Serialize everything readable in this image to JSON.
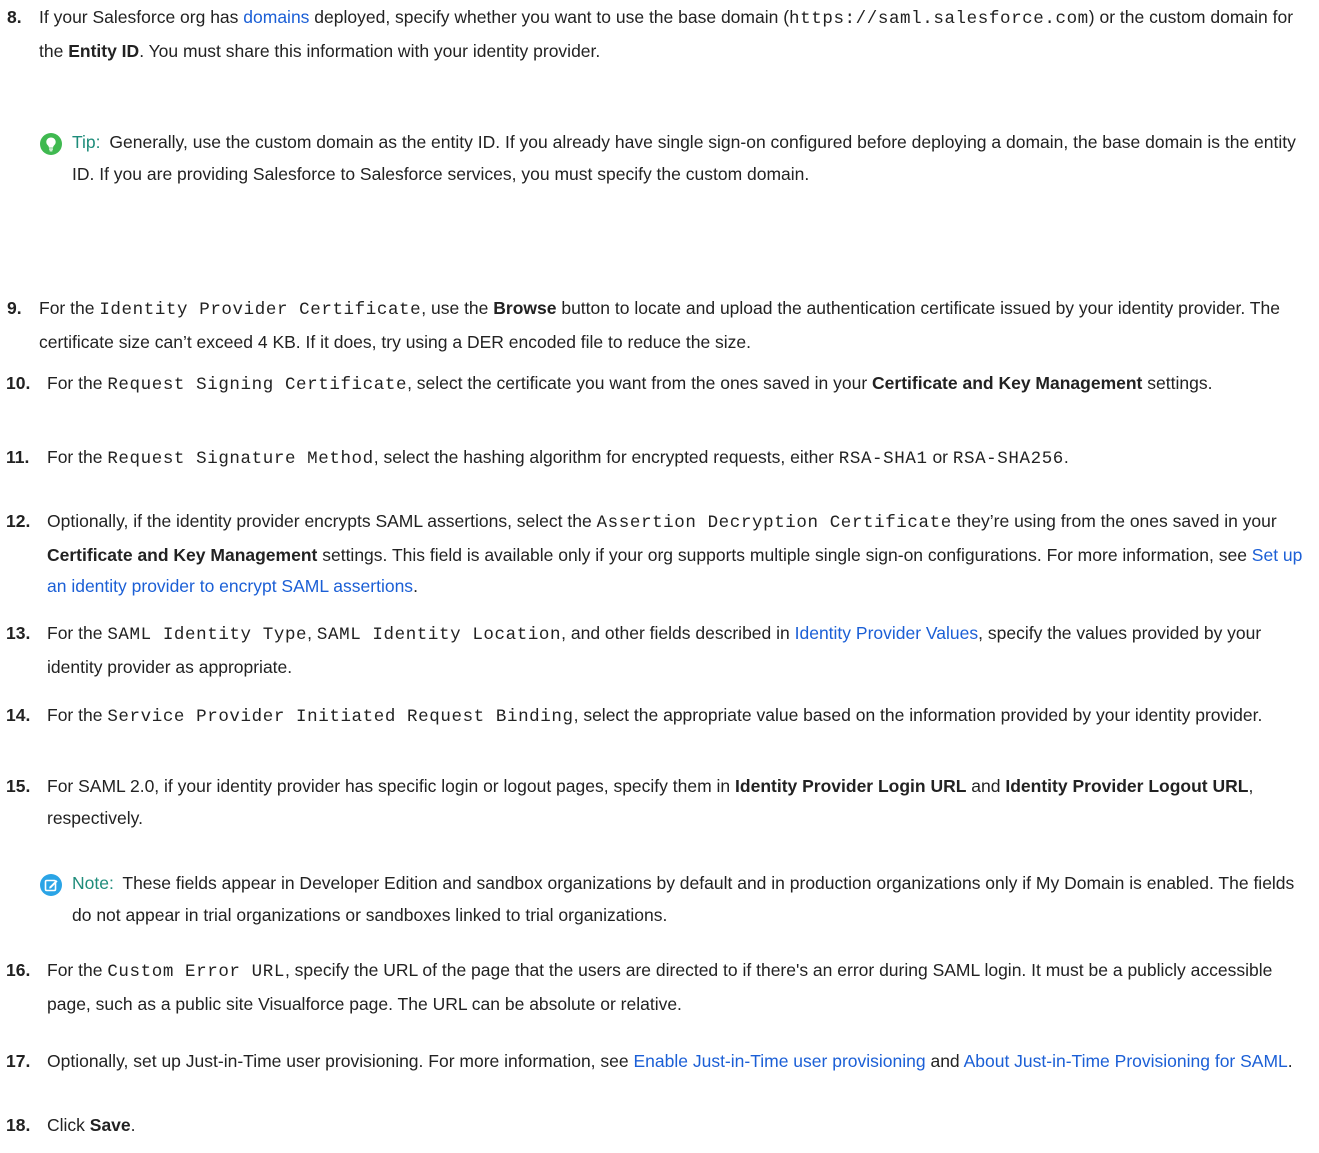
{
  "steps": [
    {
      "num": "8.",
      "parts": [
        {
          "t": "text",
          "v": "If your Salesforce org has "
        },
        {
          "t": "link",
          "v": "domains"
        },
        {
          "t": "text",
          "v": " deployed, specify whether you want to use the base domain ("
        },
        {
          "t": "code",
          "v": "https://saml.salesforce.com"
        },
        {
          "t": "text",
          "v": ") or the custom domain for the "
        },
        {
          "t": "bold",
          "v": "Entity ID"
        },
        {
          "t": "text",
          "v": ". You must share this information with your identity provider."
        }
      ]
    },
    {
      "num": "9.",
      "parts": [
        {
          "t": "text",
          "v": "For the "
        },
        {
          "t": "code",
          "v": "Identity Provider Certificate"
        },
        {
          "t": "text",
          "v": ", use the "
        },
        {
          "t": "bold",
          "v": "Browse"
        },
        {
          "t": "text",
          "v": " button to locate and upload the authentication certificate issued by your identity provider. The certificate size can’t exceed 4 KB. If it does, try using a DER encoded file to reduce the size."
        }
      ]
    },
    {
      "num": "10.",
      "parts": [
        {
          "t": "text",
          "v": "For the "
        },
        {
          "t": "code",
          "v": "Request Signing Certificate"
        },
        {
          "t": "text",
          "v": ", select the certificate you want from the ones saved in your "
        },
        {
          "t": "bold",
          "v": "Certificate and Key Management"
        },
        {
          "t": "text",
          "v": " settings."
        }
      ]
    },
    {
      "num": "11.",
      "parts": [
        {
          "t": "text",
          "v": "For the "
        },
        {
          "t": "code",
          "v": "Request Signature Method"
        },
        {
          "t": "text",
          "v": ", select the hashing algorithm for encrypted requests, either "
        },
        {
          "t": "code",
          "v": "RSA-SHA1"
        },
        {
          "t": "text",
          "v": " or "
        },
        {
          "t": "code",
          "v": "RSA-SHA256"
        },
        {
          "t": "text",
          "v": "."
        }
      ]
    },
    {
      "num": "12.",
      "parts": [
        {
          "t": "text",
          "v": "Optionally, if the identity provider encrypts SAML assertions, select the "
        },
        {
          "t": "code",
          "v": "Assertion Decryption Certificate"
        },
        {
          "t": "text",
          "v": " they’re using from the ones saved in your "
        },
        {
          "t": "bold",
          "v": "Certificate and Key Management"
        },
        {
          "t": "text",
          "v": " settings. This field is available only if your org supports multiple single sign-on configurations. For more information, see "
        },
        {
          "t": "link",
          "v": "Set up an identity provider to encrypt SAML assertions"
        },
        {
          "t": "text",
          "v": "."
        }
      ]
    },
    {
      "num": "13.",
      "parts": [
        {
          "t": "text",
          "v": "For the "
        },
        {
          "t": "code",
          "v": "SAML Identity Type"
        },
        {
          "t": "text",
          "v": ", "
        },
        {
          "t": "code",
          "v": "SAML Identity Location"
        },
        {
          "t": "text",
          "v": ", and other fields described in "
        },
        {
          "t": "link",
          "v": "Identity Provider Values"
        },
        {
          "t": "text",
          "v": ", specify the values provided by your identity provider as appropriate."
        }
      ]
    },
    {
      "num": "14.",
      "parts": [
        {
          "t": "text",
          "v": "For the "
        },
        {
          "t": "code",
          "v": "Service Provider Initiated Request Binding"
        },
        {
          "t": "text",
          "v": ", select the appropriate value based on the information provided by your identity provider."
        }
      ]
    },
    {
      "num": "15.",
      "parts": [
        {
          "t": "text",
          "v": "For SAML 2.0, if your identity provider has specific login or logout pages, specify them in "
        },
        {
          "t": "bold",
          "v": "Identity Provider Login URL"
        },
        {
          "t": "text",
          "v": " and "
        },
        {
          "t": "bold",
          "v": "Identity Provider Logout URL"
        },
        {
          "t": "text",
          "v": ", respectively."
        }
      ]
    },
    {
      "num": "16.",
      "parts": [
        {
          "t": "text",
          "v": "For the "
        },
        {
          "t": "code",
          "v": "Custom Error URL"
        },
        {
          "t": "text",
          "v": ", specify the URL of the page that the users are directed to if there's an error during SAML login. It must be a publicly accessible page, such as a public site Visualforce page. The URL can be absolute or relative."
        }
      ]
    },
    {
      "num": "17.",
      "parts": [
        {
          "t": "text",
          "v": "Optionally, set up Just-in-Time user provisioning. For more information, see "
        },
        {
          "t": "link",
          "v": "Enable Just-in-Time user provisioning"
        },
        {
          "t": "text",
          "v": " and "
        },
        {
          "t": "link",
          "v": "About Just-in-Time Provisioning for SAML"
        },
        {
          "t": "text",
          "v": "."
        }
      ]
    },
    {
      "num": "18.",
      "parts": [
        {
          "t": "text",
          "v": "Click "
        },
        {
          "t": "bold",
          "v": "Save"
        },
        {
          "t": "text",
          "v": "."
        }
      ]
    }
  ],
  "tip": {
    "label": "Tip:",
    "text": "Generally, use the custom domain as the entity ID. If you already have single sign-on configured before deploying a domain, the base domain is the entity ID. If you are providing Salesforce to Salesforce services, you must specify the custom domain.",
    "icon": "lightbulb-icon",
    "icon_color": "#3fb950"
  },
  "note": {
    "label": "Note:",
    "text": "These fields appear in Developer Edition and sandbox organizations by default and in production organizations only if My Domain is enabled. The fields do not appear in trial organizations or sandboxes linked to trial organizations.",
    "icon": "edit-note-icon",
    "icon_color": "#2aa4e6"
  },
  "colors": {
    "link": "#1b5fd6",
    "callout_label": "#1e8c7a",
    "text": "#222222"
  }
}
